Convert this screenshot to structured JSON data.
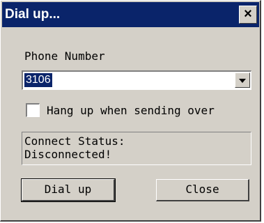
{
  "window": {
    "title": "Dial up...",
    "close_glyph": "✕"
  },
  "phone": {
    "label": "Phone Number",
    "selected_value": "3106"
  },
  "hangup_checkbox": {
    "label": "Hang up when sending over",
    "checked": false
  },
  "status": {
    "line1": "Connect Status:",
    "line2": "Disconnected!"
  },
  "buttons": {
    "dial": "Dial up",
    "close": "Close"
  },
  "colors": {
    "titlebar": "#0a246a",
    "dialog_bg": "#d4d0c8",
    "selection": "#0a246a"
  }
}
